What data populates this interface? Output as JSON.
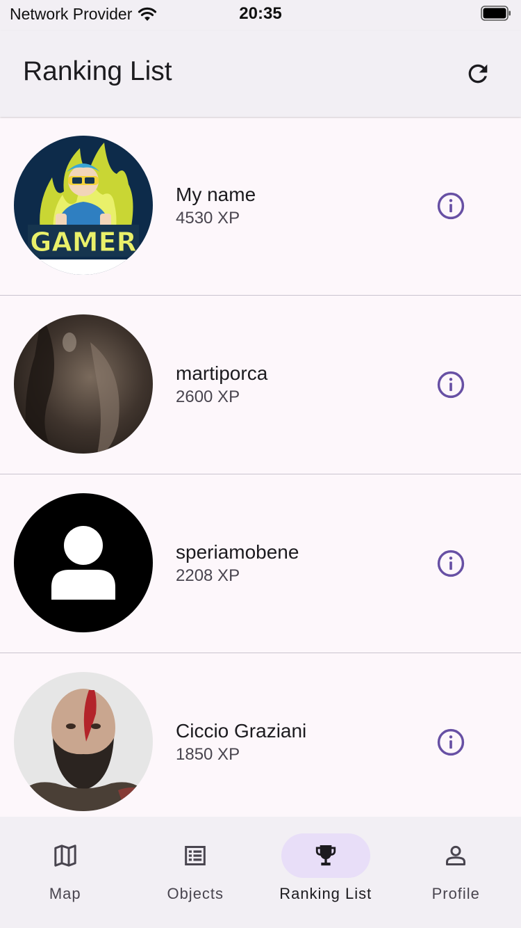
{
  "status": {
    "carrier": "Network Provider",
    "time": "20:35"
  },
  "app_bar": {
    "title": "Ranking List",
    "refresh_icon": "refresh-icon"
  },
  "users": [
    {
      "name": "My name",
      "xp": "4530 XP",
      "avatar": "gamer-logo-avatar"
    },
    {
      "name": "martiporca",
      "xp": "2600 XP",
      "avatar": "dark-photo-avatar"
    },
    {
      "name": "speriamobene",
      "xp": "2208 XP",
      "avatar": "default-person-avatar"
    },
    {
      "name": "Ciccio Graziani",
      "xp": "1850 XP",
      "avatar": "bearded-man-photo-avatar"
    }
  ],
  "nav": {
    "items": [
      {
        "label": "Map",
        "icon": "map-icon"
      },
      {
        "label": "Objects",
        "icon": "list-icon"
      },
      {
        "label": "Ranking List",
        "icon": "trophy-icon"
      },
      {
        "label": "Profile",
        "icon": "person-icon"
      }
    ],
    "active": "Ranking List"
  },
  "colors": {
    "accent": "#6750a4",
    "active_pill": "#e8def8",
    "surface": "#f2eff4",
    "background": "#fdf7fb"
  }
}
